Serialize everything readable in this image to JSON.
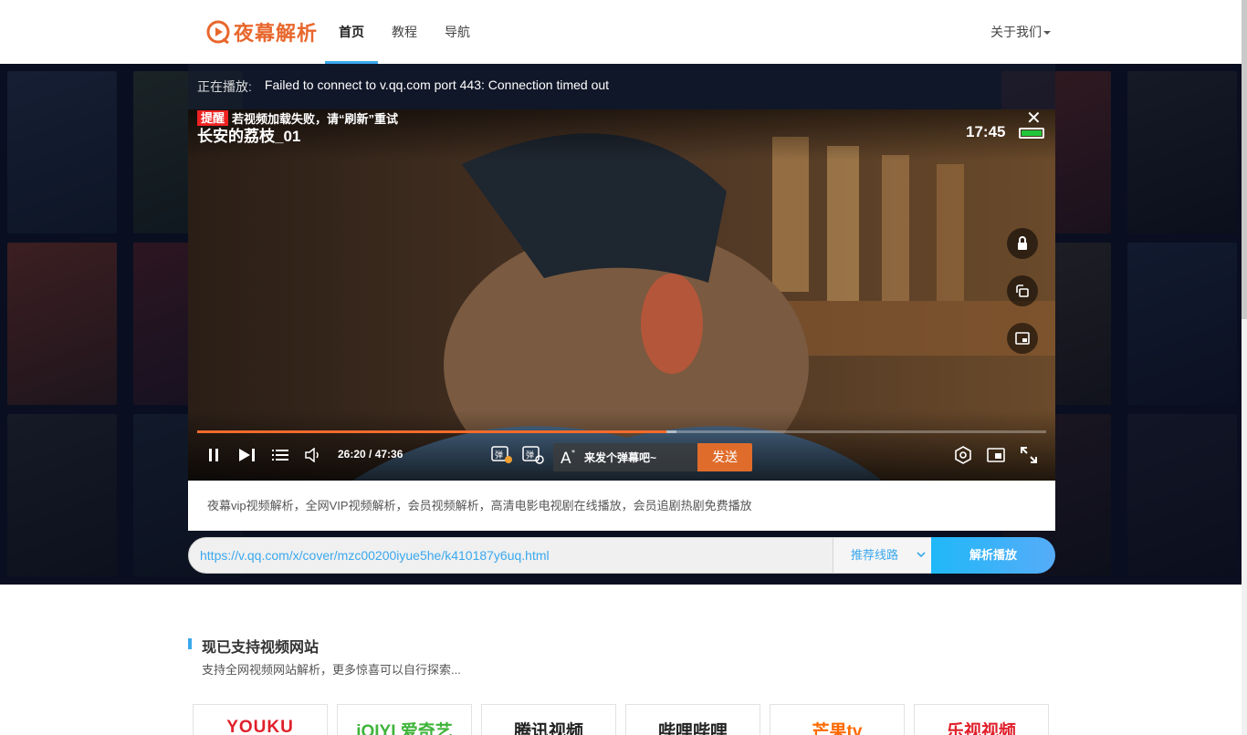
{
  "header": {
    "logo_text": "夜幕解析",
    "nav": [
      {
        "label": "首页"
      },
      {
        "label": "教程"
      },
      {
        "label": "导航"
      }
    ],
    "about_label": "关于我们"
  },
  "player": {
    "playing_label": "正在播放:",
    "playing_status": "Failed to connect to v.qq.com port 443: Connection timed out",
    "notice_tag": "提醒",
    "notice_text": "若视频加载失败，请“刷新”重试",
    "video_title": "长安的荔枝_01",
    "clock": "17:45",
    "time_display": "26:20 / 47:36",
    "progress_fraction": 0.553,
    "buffer_fraction": 0.565,
    "danmaku_placeholder": "来发个弹幕吧~",
    "send_label": "发送"
  },
  "description": "夜幕vip视频解析，全网VIP视频解析，会员视频解析，高清电影电视剧在线播放，会员追剧热剧免费播放",
  "url_bar": {
    "value": "https://v.qq.com/x/cover/mzc00200iyue5he/k410187y6uq.html",
    "line_label": "推荐线路",
    "parse_label": "解析播放"
  },
  "supported": {
    "title": "现已支持视频网站",
    "subtitle": "支持全网视频网站解析，更多惊喜可以自行探索..."
  },
  "sites": [
    {
      "name": "YOUKU",
      "color": "#e0202b"
    },
    {
      "name": "iQIYI 爱奇艺",
      "color": "#3fb43a"
    },
    {
      "name": "腾讯视频",
      "color": "#222222"
    },
    {
      "name": "哔哩哔哩",
      "color": "#222222"
    },
    {
      "name": "芒果tv",
      "color": "#ff6a00"
    },
    {
      "name": "乐视视频",
      "color": "#e0202b"
    }
  ],
  "colors": {
    "brand": "#e8672c",
    "accent": "#3aa8ee",
    "send": "#e06c2b",
    "progress": "#f26b2b"
  }
}
